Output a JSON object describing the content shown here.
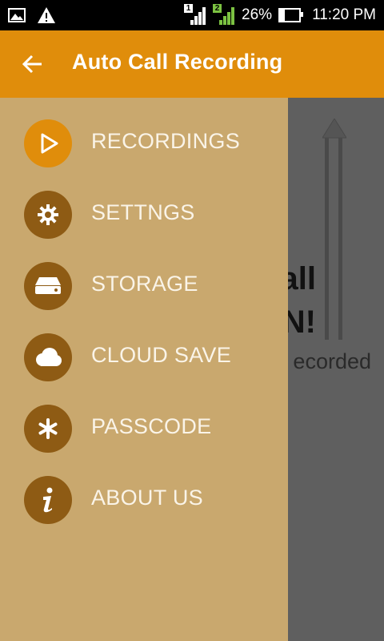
{
  "status_bar": {
    "battery_percent": "26%",
    "time": "11:20 PM",
    "sim1_label": "1",
    "sim2_label": "2"
  },
  "app_bar": {
    "title": "Auto Call Recording"
  },
  "background_content": {
    "line1_fragment": "all",
    "line2_fragment": "N!",
    "line3_fragment": "ecorded"
  },
  "drawer": {
    "items": [
      {
        "label": "RECORDINGS",
        "icon": "play-icon"
      },
      {
        "label": "SETTNGS",
        "icon": "gear-icon"
      },
      {
        "label": "STORAGE",
        "icon": "hard-drive-icon"
      },
      {
        "label": "CLOUD SAVE",
        "icon": "cloud-icon"
      },
      {
        "label": "PASSCODE",
        "icon": "asterisk-icon"
      },
      {
        "label": "ABOUT US",
        "icon": "info-icon"
      }
    ]
  },
  "colors": {
    "accent": "#e08d0b",
    "drawer_bg": "#c9a86e",
    "icon_circle": "#8e5b14",
    "scrim": "#5f5f5f"
  }
}
